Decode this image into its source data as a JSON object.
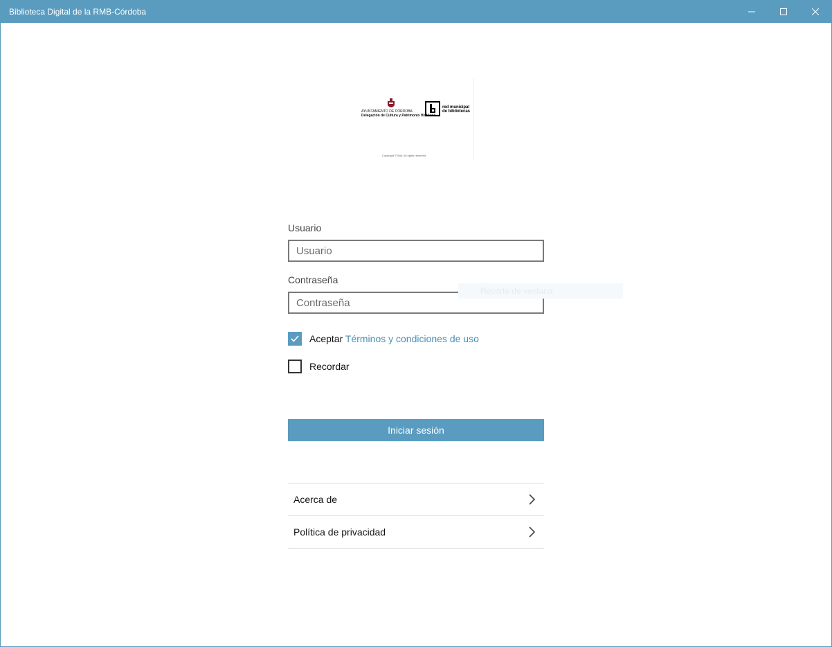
{
  "window": {
    "title": "Biblioteca Digital de la RMB-Córdoba",
    "accent_color": "#5a9cc0",
    "controls": [
      "minimize-icon",
      "maximize-icon",
      "close-icon"
    ]
  },
  "logo": {
    "crest_line1": "AYUNTAMIENTO DE CÓRDOBA",
    "crest_line2": "Delegación de Cultura y Patrimonio Histórico",
    "brand_line1": "red municipal",
    "brand_line2": "de bibliotecas",
    "copyright": "Copyright © Bidi. All rights reserved."
  },
  "form": {
    "username": {
      "label": "Usuario",
      "placeholder": "Usuario",
      "value": ""
    },
    "password": {
      "label": "Contraseña",
      "placeholder": "Contraseña",
      "value": ""
    },
    "ghost_text": "Recorte de ventana",
    "accept": {
      "label": "Aceptar",
      "link": "Términos y condiciones de uso",
      "checked": true
    },
    "remember": {
      "label": "Recordar",
      "checked": false
    },
    "login_label": "Iniciar sesión"
  },
  "menu": [
    {
      "label": "Acerca de"
    },
    {
      "label": "Política de privacidad"
    }
  ]
}
